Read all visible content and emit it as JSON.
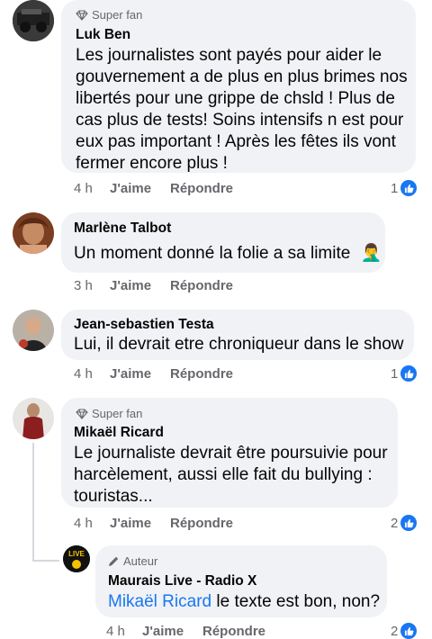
{
  "comments": [
    {
      "badge": "Super fan",
      "name": "Luk Ben",
      "text": "Les journalistes sont payés pour aider le gouvernement a de plus en plus brimes nos libertés pour une grippe de chsld  ! Plus de cas plus de tests! Soins intensifs n est pour eux pas important ! Après les fêtes ils vont fermer encore plus !",
      "time": "4 h",
      "like": "J'aime",
      "reply": "Répondre",
      "reactions": "1"
    },
    {
      "name": "Marlène Talbot",
      "text": "Un moment donné la folie a sa limite",
      "emoji": "🤦‍♂️",
      "time": "3 h",
      "like": "J'aime",
      "reply": "Répondre"
    },
    {
      "name": "Jean-sebastien Testa",
      "text": "Lui, il devrait etre chroniqueur dans le show",
      "time": "4 h",
      "like": "J'aime",
      "reply": "Répondre",
      "reactions": "1"
    },
    {
      "badge": "Super fan",
      "name": "Mikaël Ricard",
      "text": "Le journaliste devrait être poursuivie pour harcèlement, aussi elle fait du bullying : touristas...",
      "time": "4 h",
      "like": "J'aime",
      "reply": "Répondre",
      "reactions": "2"
    }
  ],
  "reply": {
    "badge": "Auteur",
    "name": "Maurais Live - Radio X",
    "mention": "Mikaël Ricard",
    "text": " le texte est bon, non?",
    "time": "4 h",
    "like": "J'aime",
    "reply": "Répondre",
    "reactions": "2",
    "avatar_text": "LIVE"
  },
  "colors": {
    "bubble": "#f0f2f5",
    "link": "#1877f2",
    "secondary_text": "#65676b",
    "like_icon": "#1877f2"
  }
}
